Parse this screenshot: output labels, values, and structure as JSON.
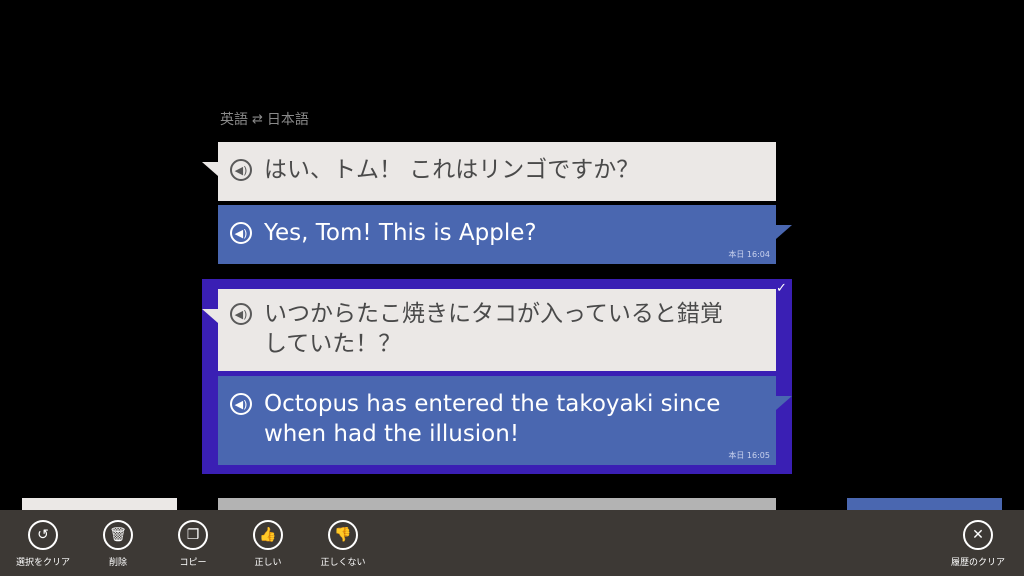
{
  "header": {
    "source_lang": "英語",
    "target_lang": "日本語",
    "swap_icon": "⇄"
  },
  "conversations": [
    {
      "source_text": "はい、トム！ これはリンゴですか？",
      "translation": "Yes, Tom! This is Apple?",
      "timestamp": "本日 16:04"
    },
    {
      "source_text": "いつからたこ焼きにタコが入っていると錯覚していた！？",
      "translation": "Octopus has entered the takoyaki since when had the illusion!",
      "timestamp": "本日 16:05",
      "selected": true
    }
  ],
  "appbar": {
    "clear_selection": "選択をクリア",
    "delete": "削除",
    "copy": "コピー",
    "correct": "正しい",
    "incorrect": "正しくない",
    "clear_history": "履歴のクリア"
  },
  "colors": {
    "source_bubble": "#ebe8e6",
    "translation_bubble": "#4a67b0",
    "selection": "#3a1fb4",
    "appbar": "#3d3935"
  }
}
